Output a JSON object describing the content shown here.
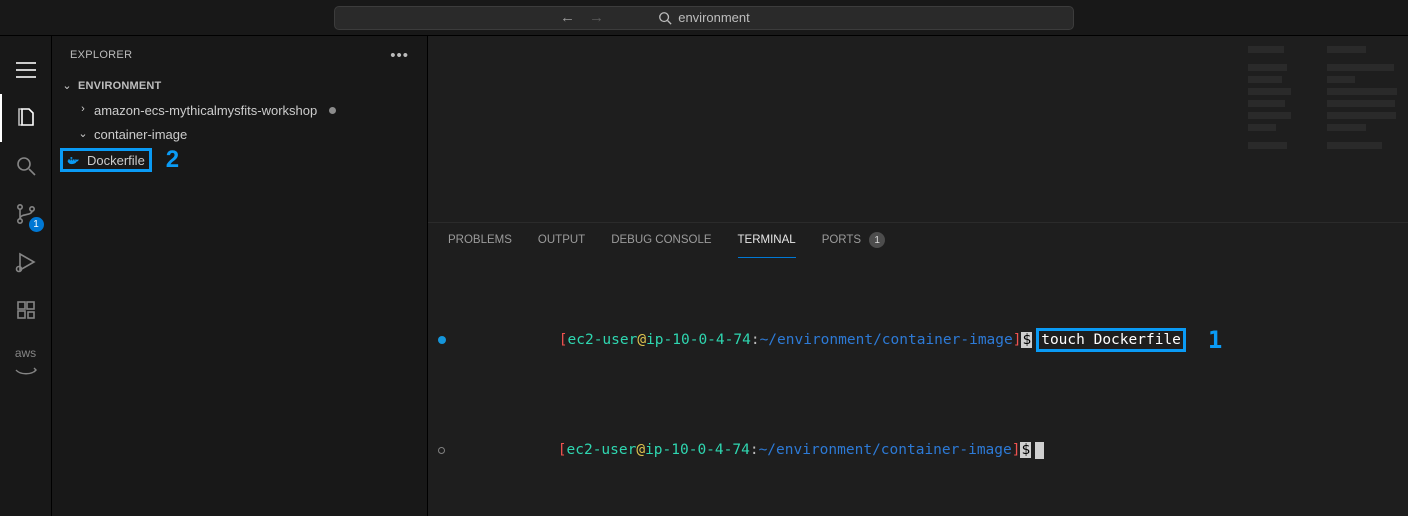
{
  "search": {
    "text": "environment"
  },
  "sidebar": {
    "title": "EXPLORER",
    "section": "ENVIRONMENT",
    "items": {
      "workshop": "amazon-ecs-mythicalmysfits-workshop",
      "container": "container-image",
      "dockerfile": "Dockerfile"
    }
  },
  "activity": {
    "scm_badge": "1",
    "aws_label": "aws"
  },
  "annotations": {
    "one": "1",
    "two": "2"
  },
  "panel": {
    "tabs": {
      "problems": "PROBLEMS",
      "output": "OUTPUT",
      "debug": "DEBUG CONSOLE",
      "terminal": "TERMINAL",
      "ports": "PORTS",
      "ports_count": "1"
    }
  },
  "terminal": {
    "user": "ec2-user",
    "at": "@",
    "host": "ip-10-0-4-74",
    "colon": ":",
    "path": "~/environment/container-image",
    "open": "[",
    "close": "]",
    "dollar": "$",
    "cmd1": "touch Dockerfile"
  }
}
